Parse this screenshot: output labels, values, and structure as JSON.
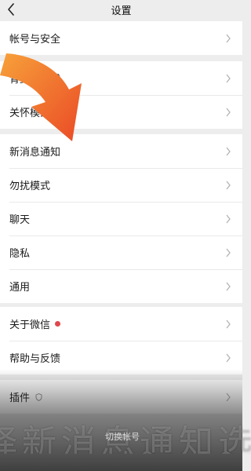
{
  "header": {
    "title": "设置"
  },
  "groups": [
    {
      "items": [
        {
          "label": "帐号与安全"
        }
      ]
    },
    {
      "items": [
        {
          "label": "青少年模式"
        },
        {
          "label": "关怀模式"
        }
      ]
    },
    {
      "items": [
        {
          "label": "新消息通知"
        },
        {
          "label": "勿扰模式"
        },
        {
          "label": "聊天"
        },
        {
          "label": "隐私"
        },
        {
          "label": "通用"
        }
      ]
    },
    {
      "items": [
        {
          "label": "关于微信",
          "badge": "red-dot"
        },
        {
          "label": "帮助与反馈"
        }
      ]
    },
    {
      "items": [
        {
          "label": "插件",
          "icon": "shield-icon"
        }
      ]
    }
  ],
  "overlay": {
    "caption": "择新消息通知选",
    "bottom_label": "切换帐号",
    "arrow_color": "#f0652a"
  },
  "colors": {
    "badge": "#e0474c",
    "background": "#ededed",
    "card": "#ffffff"
  }
}
